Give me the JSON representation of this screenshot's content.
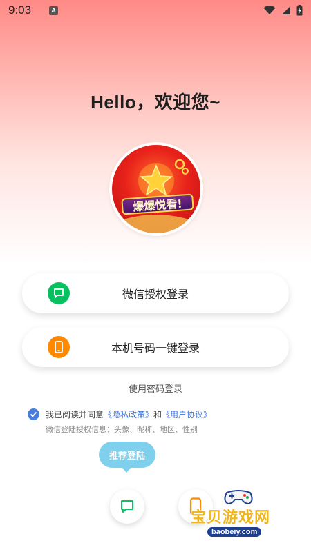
{
  "status_bar": {
    "time": "9:03",
    "notification_letter": "A"
  },
  "greeting": "Hello，欢迎您~",
  "logo": {
    "text": "爆爆悦看!"
  },
  "buttons": {
    "wechat_login": "微信授权登录",
    "phone_login": "本机号码一键登录",
    "password_login": "使用密码登录"
  },
  "agreement": {
    "prefix": "我已阅读并同意",
    "privacy_link": "《隐私政策》",
    "and": "和",
    "user_link": "《用户协议》",
    "wechat_info": "微信登陆授权信息：头像、昵称、地区、性别"
  },
  "tooltip": "推荐登陆",
  "watermark": {
    "title": "宝贝游戏网",
    "url": "baobeiy.com"
  },
  "colors": {
    "wechat_green": "#07c160",
    "phone_orange": "#ff8a00",
    "link_blue": "#3d73d9",
    "tooltip_blue": "#7fd0ec"
  },
  "icons": [
    "wifi-icon",
    "signal-icon",
    "battery-icon",
    "chat-bubble-icon",
    "phone-icon",
    "check-icon"
  ]
}
